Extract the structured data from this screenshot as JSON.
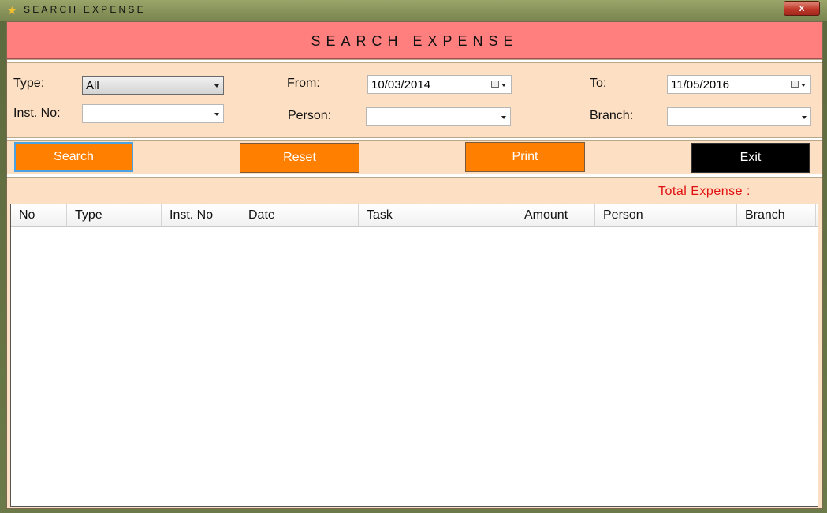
{
  "window": {
    "title": "SEARCH EXPENSE",
    "icon": "star-icon",
    "close_label": "x",
    "header_title": "SEARCH EXPENSE"
  },
  "filters": {
    "type_label": "Type:",
    "type_value": "All",
    "inst_no_label": "Inst. No:",
    "inst_no_value": "",
    "from_label": "From:",
    "from_value": "10/03/2014",
    "person_label": "Person:",
    "person_value": "",
    "to_label": "To:",
    "to_value": "11/05/2016",
    "branch_label": "Branch:",
    "branch_value": ""
  },
  "buttons": {
    "search": "Search",
    "reset": "Reset",
    "print": "Print",
    "exit": "Exit"
  },
  "summary": {
    "total_label": "Total Expense :"
  },
  "table": {
    "columns": [
      "No",
      "Type",
      "Inst. No",
      "Date",
      "Task",
      "Amount",
      "Person",
      "Branch"
    ],
    "rows": []
  },
  "colors": {
    "header_band": "#ff7f7f",
    "panel": "#fde0c4",
    "button_orange": "#ff8000",
    "button_exit": "#000000",
    "total_text": "#e01010"
  }
}
